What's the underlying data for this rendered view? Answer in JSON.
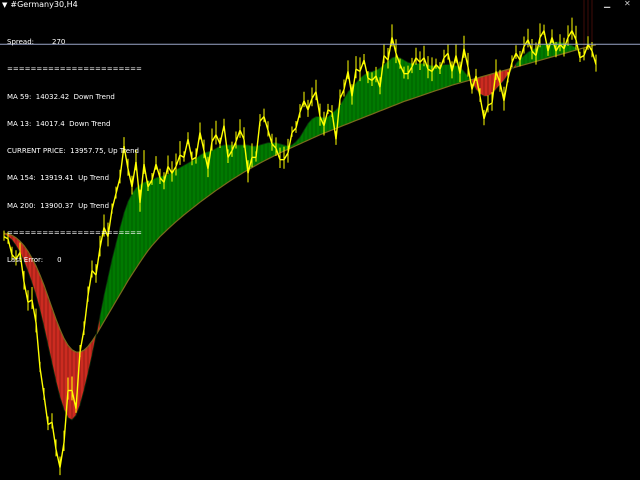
{
  "window": {
    "title": "#Germany30,H4",
    "min_btn": "▁",
    "close_btn": "✕"
  },
  "info_panel": {
    "spread_label": "Spread:",
    "spread_value": "270",
    "separator": "=======================",
    "ma59": "MA 59:  14032.42  Down Trend",
    "ma13": "MA 13:  14017.4  Down Trend",
    "current_price": "CURRENT PRICE:  13957.75, Up Trend",
    "ma154": "MA 154:  13919.41  Up Trend",
    "ma200": "MA 200:  13900.37  Up Trend",
    "separator2": "=======================",
    "last_error_label": "Last Error:",
    "last_error_value": "0"
  },
  "colors": {
    "background": "#000000",
    "price": "#ffff00",
    "up_fill": "#007a00",
    "down_fill": "#cc2b20",
    "slow_ma": "#7a6a1c",
    "price_line": "#9aa6c8"
  },
  "chart_data": {
    "type": "line",
    "x": [
      0,
      4,
      8,
      12,
      16,
      20,
      24,
      28,
      32,
      36,
      40,
      44,
      48,
      52,
      56,
      60,
      64,
      68,
      72,
      76,
      80,
      84,
      88,
      92,
      96,
      100,
      104,
      108,
      112,
      116,
      120,
      124,
      128,
      132,
      136,
      140,
      144,
      148,
      152,
      156,
      160,
      164,
      168,
      172,
      176,
      180,
      184,
      188,
      192,
      196,
      200,
      204,
      208,
      212,
      216,
      220,
      224,
      228,
      232,
      236,
      240,
      244,
      248,
      252,
      256,
      260,
      264,
      268,
      272,
      276,
      280,
      284,
      288,
      292,
      296,
      300,
      304,
      308,
      312,
      316,
      320,
      324,
      328,
      332,
      336,
      340,
      344,
      348,
      352,
      356,
      360,
      364,
      368,
      372,
      376,
      380,
      384,
      388,
      392,
      396,
      400,
      404,
      408,
      412,
      416,
      420,
      424,
      428,
      432,
      436,
      440,
      444,
      448,
      452,
      456,
      460,
      464,
      468,
      472,
      476,
      480,
      484,
      488,
      492,
      496,
      500,
      504,
      508,
      512,
      516,
      520,
      524,
      528,
      532,
      536,
      540,
      544,
      548,
      552,
      556,
      560,
      564,
      568,
      572,
      576,
      580,
      584,
      588,
      592
    ],
    "series": [
      {
        "role": "price",
        "values": [
          13340,
          13330,
          13260,
          13240,
          13270,
          13140,
          13050,
          13060,
          12960,
          12760,
          12640,
          12510,
          12520,
          12400,
          12320,
          12430,
          12660,
          12660,
          12580,
          12830,
          12930,
          13080,
          13190,
          13170,
          13290,
          13380,
          13340,
          13460,
          13530,
          13600,
          13740,
          13640,
          13560,
          13670,
          13490,
          13660,
          13560,
          13590,
          13660,
          13600,
          13580,
          13650,
          13620,
          13650,
          13700,
          13690,
          13770,
          13680,
          13690,
          13800,
          13720,
          13640,
          13760,
          13790,
          13750,
          13830,
          13690,
          13720,
          13760,
          13810,
          13770,
          13620,
          13690,
          13690,
          13850,
          13870,
          13810,
          13750,
          13730,
          13680,
          13680,
          13710,
          13800,
          13820,
          13890,
          13940,
          13900,
          13950,
          13980,
          13870,
          13830,
          13900,
          13890,
          13770,
          13950,
          13990,
          14070,
          13960,
          14080,
          14070,
          14120,
          14040,
          14030,
          14050,
          14000,
          14140,
          14120,
          14220,
          14150,
          14100,
          14060,
          14060,
          14090,
          14130,
          14110,
          14130,
          14080,
          14070,
          14100,
          14080,
          14130,
          14150,
          14070,
          14140,
          14060,
          14170,
          14090,
          13990,
          14050,
          13960,
          13860,
          13920,
          13930,
          14070,
          14020,
          13940,
          14040,
          14110,
          14150,
          14120,
          14180,
          14210,
          14160,
          14140,
          14220,
          14250,
          14160,
          14220,
          14160,
          14190,
          14170,
          14220,
          14250,
          14210,
          14130,
          14140,
          14190,
          14160,
          14100
        ]
      },
      {
        "role": "fast_ma",
        "values": [
          13350,
          13340,
          13325,
          13300,
          13270,
          13230,
          13185,
          13135,
          13080,
          13015,
          12940,
          12860,
          12780,
          12700,
          12630,
          12575,
          12540,
          12530,
          12550,
          12595,
          12660,
          12735,
          12815,
          12900,
          12990,
          13080,
          13160,
          13240,
          13310,
          13380,
          13445,
          13495,
          13530,
          13555,
          13570,
          13580,
          13585,
          13590,
          13600,
          13605,
          13610,
          13615,
          13625,
          13635,
          13645,
          13655,
          13665,
          13675,
          13685,
          13700,
          13710,
          13715,
          13720,
          13730,
          13740,
          13745,
          13745,
          13745,
          13745,
          13745,
          13745,
          13745,
          13740,
          13740,
          13745,
          13750,
          13755,
          13755,
          13755,
          13750,
          13745,
          13740,
          13745,
          13760,
          13780,
          13810,
          13840,
          13860,
          13870,
          13870,
          13865,
          13870,
          13885,
          13900,
          13920,
          13950,
          13980,
          14000,
          14020,
          14040,
          14055,
          14065,
          14070,
          14075,
          14085,
          14100,
          14115,
          14130,
          14135,
          14130,
          14120,
          14110,
          14105,
          14105,
          14105,
          14105,
          14100,
          14095,
          14095,
          14095,
          14100,
          14100,
          14100,
          14095,
          14090,
          14070,
          14050,
          14020,
          13990,
          13970,
          13960,
          13960,
          13970,
          13990,
          14010,
          14030,
          14055,
          14080,
          14105,
          14125,
          14140,
          14155,
          14165,
          14175,
          14185,
          14190,
          14195,
          14200,
          14200,
          14200,
          14195,
          14190,
          14185,
          14175,
          14160
        ]
      },
      {
        "role": "slow_ma",
        "values": [
          13355,
          13352,
          13346,
          13335,
          13320,
          13300,
          13275,
          13245,
          13210,
          13170,
          13125,
          13075,
          13025,
          12975,
          12930,
          12890,
          12860,
          12840,
          12830,
          12830,
          12838,
          12855,
          12878,
          12905,
          12935,
          12965,
          12995,
          13025,
          13055,
          13085,
          13115,
          13145,
          13173,
          13200,
          13227,
          13253,
          13278,
          13300,
          13320,
          13340,
          13357,
          13374,
          13390,
          13406,
          13421,
          13436,
          13450,
          13464,
          13478,
          13492,
          13505,
          13518,
          13531,
          13544,
          13556,
          13568,
          13580,
          13592,
          13603,
          13614,
          13625,
          13635,
          13645,
          13655,
          13665,
          13674,
          13683,
          13692,
          13701,
          13710,
          13718,
          13726,
          13734,
          13742,
          13750,
          13758,
          13766,
          13774,
          13782,
          13790,
          13797,
          13804,
          13811,
          13818,
          13825,
          13832,
          13839,
          13846,
          13853,
          13860,
          13867,
          13874,
          13881,
          13888,
          13895,
          13902,
          13909,
          13916,
          13923,
          13930,
          13937,
          13943,
          13949,
          13955,
          13961,
          13967,
          13973,
          13979,
          13985,
          13991,
          13997,
          14003,
          14009,
          14014,
          14019,
          14024,
          14029,
          14034,
          14039,
          14044,
          14049,
          14054,
          14059,
          14064,
          14069,
          14074,
          14079,
          14084,
          14089,
          14094,
          14099,
          14104,
          14109,
          14114,
          14119,
          14124,
          14129,
          14134,
          14139,
          14144,
          14149,
          14154,
          14159,
          14164,
          14169,
          14174,
          14179,
          14183,
          14187
        ]
      }
    ],
    "price_line_y": 14190,
    "ylim": [
      12300,
      14350
    ],
    "xlim": [
      0,
      640
    ],
    "grid": false
  }
}
